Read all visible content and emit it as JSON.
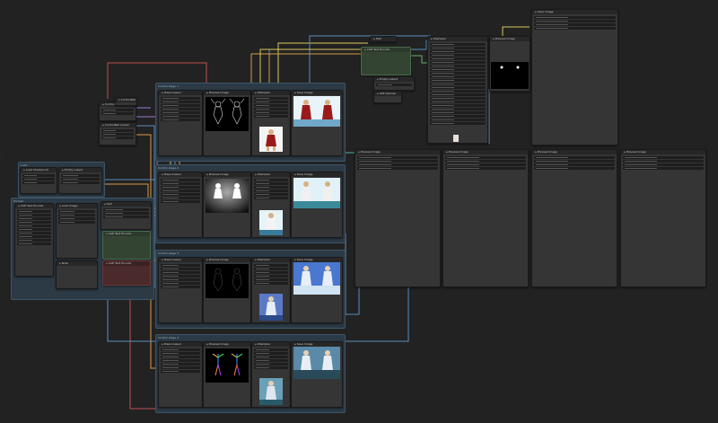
{
  "side_note": [
    "...",
    "..",
    "."
  ],
  "groups": [
    {
      "title": "Control stage 1"
    },
    {
      "title": "Control stage 2"
    },
    {
      "title": "Control stage 3"
    },
    {
      "title": "Control stage 4"
    },
    {
      "title": "Load"
    },
    {
      "title": "Prompt"
    }
  ],
  "nodes": {
    "checkpoint": "Load Checkpoint",
    "clip_text": "CLIP Text Encode",
    "sampler": "KSampler",
    "vae_decode": "VAE Decode",
    "save_image": "Save Image",
    "preview_a": "Preview Image",
    "preview_b": "Preview Image",
    "preview_c": "Preview Image",
    "preview_d": "Preview Image",
    "controlnet_loader": "ControlNet Loader",
    "apply_controlnet": "Apply ControlNet",
    "preprocessor": "Preprocessor",
    "load_image": "Load Image",
    "empty_latent": "Empty Latent",
    "note": "Note",
    "text": "Text"
  },
  "colors": {
    "wire_blue": "#5b8fbf",
    "wire_orange": "#d89a4a",
    "wire_yellow": "#d8c85a",
    "wire_red": "#c05050",
    "wire_purple": "#9a7ad0",
    "wire_green": "#6ab06a",
    "wire_teal": "#4ab0b0"
  }
}
